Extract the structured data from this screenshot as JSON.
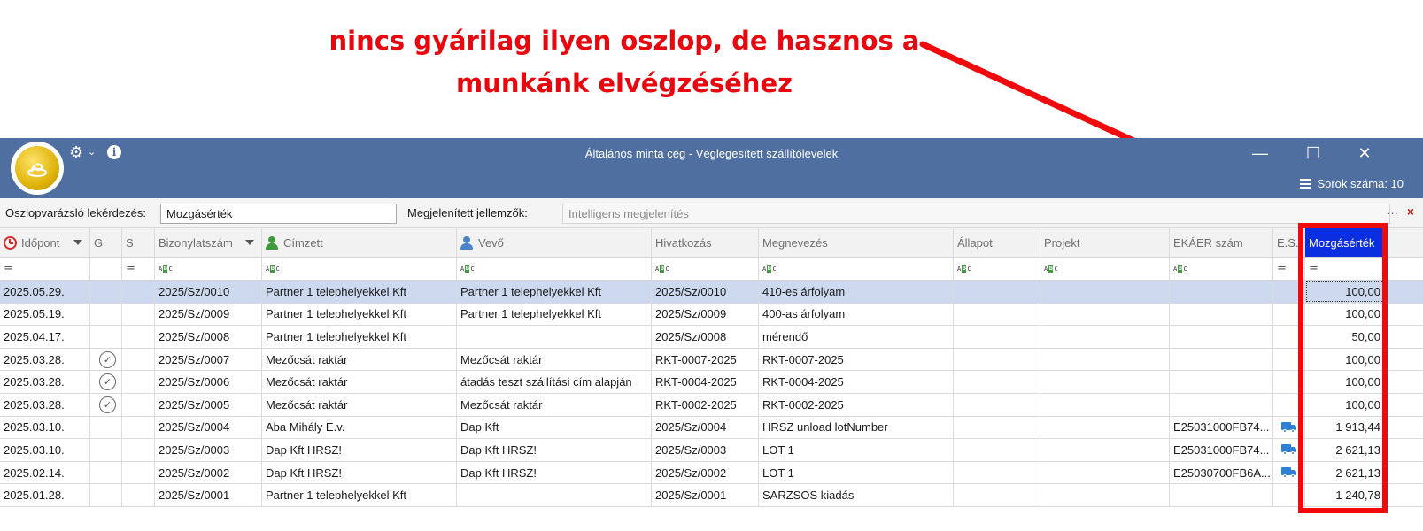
{
  "annotation": {
    "line1": "nincs gyárilag ilyen oszlop, de hasznos a",
    "line2": "munkánk elvégzéséhez",
    "color": "#e8070f"
  },
  "window": {
    "title": "Általános minta cég - Véglegesített szállítólevelek",
    "rows_count_label": "Sorok száma: 10",
    "minimize_symbol": "—",
    "maximize_symbol": "☐",
    "close_symbol": "✕",
    "titlebar_color": "#4f6fa1"
  },
  "filterbar": {
    "query_label": "Oszlopvarázsló lekérdezés:",
    "query_value": "Mozgásérték",
    "shown_label": "Megjelenített jellemzők:",
    "shown_value": "Intelligens megjelenítés",
    "more_symbol": "···",
    "clear_symbol": "×"
  },
  "columns": [
    {
      "label": "Időpont",
      "icon": "clock-icon",
      "sort": true,
      "filter": "eq"
    },
    {
      "label": "G",
      "filter": ""
    },
    {
      "label": "S",
      "filter": "eq"
    },
    {
      "label": "Bizonylatszám",
      "sort": true,
      "filter": "abc"
    },
    {
      "label": "Címzett",
      "icon": "person-green-icon",
      "filter": "abc"
    },
    {
      "label": "Vevő",
      "icon": "person-blue-icon",
      "filter": "abc"
    },
    {
      "label": "Hivatkozás",
      "filter": "abc"
    },
    {
      "label": "Megnevezés",
      "filter": "abc"
    },
    {
      "label": "Állapot",
      "filter": "abc"
    },
    {
      "label": "Projekt",
      "filter": "abc"
    },
    {
      "label": "EKÁER szám",
      "filter": "abc"
    },
    {
      "label": "E.S.",
      "filter": "eq"
    },
    {
      "label": "Mozgásérték",
      "active": true,
      "filter": "eq"
    }
  ],
  "rows": [
    {
      "date": "2025.05.29.",
      "g": false,
      "doc": "2025/Sz/0010",
      "recipient": "Partner 1 telephelyekkel Kft",
      "customer": "Partner 1 telephelyekkel Kft",
      "ref": "2025/Sz/0010",
      "name": "410-es árfolyam",
      "ekaer": "",
      "truck": false,
      "value": "100,00",
      "selected": true
    },
    {
      "date": "2025.05.19.",
      "g": false,
      "doc": "2025/Sz/0009",
      "recipient": "Partner 1 telephelyekkel Kft",
      "customer": "Partner 1 telephelyekkel Kft",
      "ref": "2025/Sz/0009",
      "name": "400-as árfolyam",
      "ekaer": "",
      "truck": false,
      "value": "100,00"
    },
    {
      "date": "2025.04.17.",
      "g": false,
      "doc": "2025/Sz/0008",
      "recipient": "Partner 1 telephelyekkel Kft",
      "customer": "",
      "ref": "2025/Sz/0008",
      "name": "mérendő",
      "ekaer": "",
      "truck": false,
      "value": "50,00"
    },
    {
      "date": "2025.03.28.",
      "g": true,
      "doc": "2025/Sz/0007",
      "recipient": "Mezőcsát raktár",
      "customer": "Mezőcsát raktár",
      "ref": "RKT-0007-2025",
      "name": "RKT-0007-2025",
      "ekaer": "",
      "truck": false,
      "value": "100,00"
    },
    {
      "date": "2025.03.28.",
      "g": true,
      "doc": "2025/Sz/0006",
      "recipient": "Mezőcsát raktár",
      "customer": "átadás teszt szállítási cím alapján",
      "ref": "RKT-0004-2025",
      "name": "RKT-0004-2025",
      "ekaer": "",
      "truck": false,
      "value": "100,00"
    },
    {
      "date": "2025.03.28.",
      "g": true,
      "doc": "2025/Sz/0005",
      "recipient": "Mezőcsát raktár",
      "customer": "Mezőcsát raktár",
      "ref": "RKT-0002-2025",
      "name": "RKT-0002-2025",
      "ekaer": "",
      "truck": false,
      "value": "100,00"
    },
    {
      "date": "2025.03.10.",
      "g": false,
      "doc": "2025/Sz/0004",
      "recipient": "Aba Mihály E.v.",
      "customer": "Dap Kft",
      "ref": "2025/Sz/0004",
      "name": "HRSZ unload lotNumber",
      "ekaer": "E25031000FB74...",
      "truck": true,
      "value": "1 913,44"
    },
    {
      "date": "2025.03.10.",
      "g": false,
      "doc": "2025/Sz/0003",
      "recipient": "Dap Kft HRSZ!",
      "customer": "Dap Kft HRSZ!",
      "ref": "2025/Sz/0003",
      "name": "LOT 1",
      "ekaer": "E25031000FB74...",
      "truck": true,
      "value": "2 621,13"
    },
    {
      "date": "2025.02.14.",
      "g": false,
      "doc": "2025/Sz/0002",
      "recipient": "Dap Kft HRSZ!",
      "customer": "Dap Kft HRSZ!",
      "ref": "2025/Sz/0002",
      "name": "LOT 1",
      "ekaer": "E25030700FB6A...",
      "truck": true,
      "value": "2 621,13"
    },
    {
      "date": "2025.01.28.",
      "g": false,
      "doc": "2025/Sz/0001",
      "recipient": "Partner 1 telephelyekkel Kft",
      "customer": "",
      "ref": "2025/Sz/0001",
      "name": "SARZSOS kiadás",
      "ekaer": "",
      "truck": false,
      "value": "1 240,78"
    }
  ]
}
